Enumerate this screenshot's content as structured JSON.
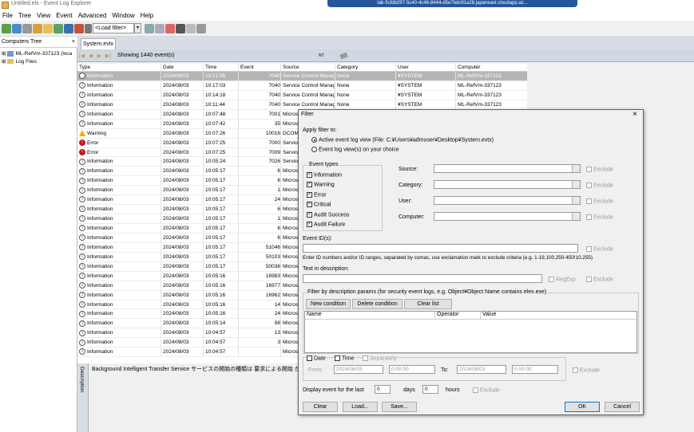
{
  "app": {
    "title": "Untitled.elx - Event Log Explorer",
    "rdp_banner": "lab-5cfdb297-5c40-4c46-8444-d5e7bdc91a28.japaneast.cloudapp.az..."
  },
  "menu": [
    "File",
    "Tree",
    "View",
    "Event",
    "Advanced",
    "Window",
    "Help"
  ],
  "toolbar": {
    "filter_combo": "<Load filter>"
  },
  "tree": {
    "title": "Computers Tree",
    "close": "×",
    "items": [
      "ML-RefVm-337123 (loca",
      "Log Files"
    ]
  },
  "tab": {
    "label": "System.evtx"
  },
  "nav": {
    "status": "Showing 1440 event(s)",
    "nt_label": "NT"
  },
  "grid": {
    "columns": [
      "Type",
      "Date",
      "Time",
      "Event",
      "Source",
      "Category",
      "User",
      "Computer"
    ],
    "rows": [
      [
        "Information",
        "2024/08/03",
        "10:21:56",
        "7040",
        "Service Control Manag",
        "None",
        "¥SYSTEM",
        "ML-RefVm-337123"
      ],
      [
        "Information",
        "2024/08/03",
        "10:17:03",
        "7040",
        "Service Control Manag",
        "None",
        "¥SYSTEM",
        "ML-RefVm-337123"
      ],
      [
        "Information",
        "2024/08/03",
        "10:14:18",
        "7040",
        "Service Control Manag",
        "None",
        "¥SYSTEM",
        "ML-RefVm-337123"
      ],
      [
        "Information",
        "2024/08/03",
        "10:11:44",
        "7040",
        "Service Control Manag",
        "None",
        "¥SYSTEM",
        "ML-RefVm-337123"
      ],
      [
        "Information",
        "2024/08/03",
        "10:07:48",
        "7001",
        "Microso",
        "",
        "",
        ""
      ],
      [
        "Information",
        "2024/08/03",
        "10:07:42",
        "35",
        "Microso",
        "",
        "",
        ""
      ],
      [
        "Warning",
        "2024/08/03",
        "10:07:26",
        "10016",
        "DCOM",
        "",
        "",
        ""
      ],
      [
        "Error",
        "2024/08/03",
        "10:07:25",
        "7000",
        "Service",
        "",
        "",
        ""
      ],
      [
        "Error",
        "2024/08/03",
        "10:07:25",
        "7009",
        "Service",
        "",
        "",
        ""
      ],
      [
        "Information",
        "2024/08/03",
        "10:05:24",
        "7026",
        "Service",
        "",
        "",
        ""
      ],
      [
        "Information",
        "2024/08/03",
        "10:05:17",
        "6",
        "Microso",
        "",
        "",
        ""
      ],
      [
        "Information",
        "2024/08/03",
        "10:05:17",
        "6",
        "Microso",
        "",
        "",
        ""
      ],
      [
        "Information",
        "2024/08/03",
        "10:05:17",
        "1",
        "Microso",
        "",
        "",
        ""
      ],
      [
        "Information",
        "2024/08/03",
        "10:05:17",
        "24",
        "Microso",
        "",
        "",
        ""
      ],
      [
        "Information",
        "2024/08/03",
        "10:05:17",
        "6",
        "Microso",
        "",
        "",
        ""
      ],
      [
        "Information",
        "2024/08/03",
        "10:05:17",
        "1",
        "Microso",
        "",
        "",
        ""
      ],
      [
        "Information",
        "2024/08/03",
        "10:05:17",
        "6",
        "Microso",
        "",
        "",
        ""
      ],
      [
        "Information",
        "2024/08/03",
        "10:05:17",
        "6",
        "Microso",
        "",
        "",
        ""
      ],
      [
        "Information",
        "2024/08/03",
        "10:05:17",
        "51046",
        "Microso",
        "",
        "",
        ""
      ],
      [
        "Information",
        "2024/08/03",
        "10:05:17",
        "50103",
        "Microso",
        "",
        "",
        ""
      ],
      [
        "Information",
        "2024/08/03",
        "10:05:17",
        "50036",
        "Microso",
        "",
        "",
        ""
      ],
      [
        "Information",
        "2024/08/03",
        "10:05:16",
        "16983",
        "Microso",
        "",
        "",
        ""
      ],
      [
        "Information",
        "2024/08/03",
        "10:05:16",
        "16977",
        "Microso",
        "",
        "",
        ""
      ],
      [
        "Information",
        "2024/08/03",
        "10:05:16",
        "16962",
        "Microso",
        "",
        "",
        ""
      ],
      [
        "Information",
        "2024/08/03",
        "10:05:16",
        "14",
        "Microso",
        "",
        "",
        ""
      ],
      [
        "Information",
        "2024/08/03",
        "10:05:16",
        "24",
        "Microso",
        "",
        "",
        ""
      ],
      [
        "Information",
        "2024/08/03",
        "10:05:14",
        "98",
        "Microso",
        "",
        "",
        ""
      ],
      [
        "Information",
        "2024/08/03",
        "10:04:57",
        "13",
        "Microso",
        "",
        "",
        ""
      ],
      [
        "Information",
        "2024/08/03",
        "10:04:57",
        "3",
        "Microso",
        "",
        "",
        ""
      ],
      [
        "Information",
        "2024/08/03",
        "10:04:57",
        "",
        "Microso",
        "",
        "",
        ""
      ]
    ]
  },
  "description": {
    "label": "Description",
    "text": "Background Intelligent Transfer Service サービスの開始の種類は 要求による開始 か"
  },
  "filter": {
    "title": "Filter",
    "close": "×",
    "apply_to": "Apply filter to:",
    "radio_active": "Active event log view (File: C:¥Users¥admuser¥Desktop¥System.evtx)",
    "radio_views": "Event log view(s) on your choice",
    "event_types": "Event types",
    "types": [
      "Information",
      "Warning",
      "Error",
      "Critical",
      "Audit Success",
      "Audit Failure"
    ],
    "source": "Source:",
    "category": "Category:",
    "user": "User:",
    "computer": "Computer:",
    "exclude": "Exclude",
    "event_ids": "Event ID(s):",
    "event_ids_hint": "Enter ID numbers and/or ID ranges, separated by comas, use exclamation mark to exclude criteria (e.g. 1-19,100,250-450!10,255)",
    "text_desc": "Text in description:",
    "regexp": "RegExp",
    "desc_params": "Filter by description params (for security event logs, e.g. Object¥Object Name contains elex.exe)",
    "new_cond": "New condition",
    "del_cond": "Delete condition",
    "clear_list": "Clear list",
    "cols": [
      "Name",
      "Operator",
      "Value"
    ],
    "date": "Date",
    "time": "Time",
    "separately": "Separately",
    "from": "From:",
    "to": "To:",
    "from_date": "2024/08/03",
    "from_time": "0:00:00",
    "to_date": "2024/08/03",
    "to_time": "0:00:00",
    "display_last": "Display event for the last",
    "days_val": "0",
    "days": "days",
    "hours_val": "0",
    "hours": "hours",
    "clear": "Clear",
    "load": "Load...",
    "save": "Save...",
    "ok": "OK",
    "cancel": "Cancel"
  }
}
